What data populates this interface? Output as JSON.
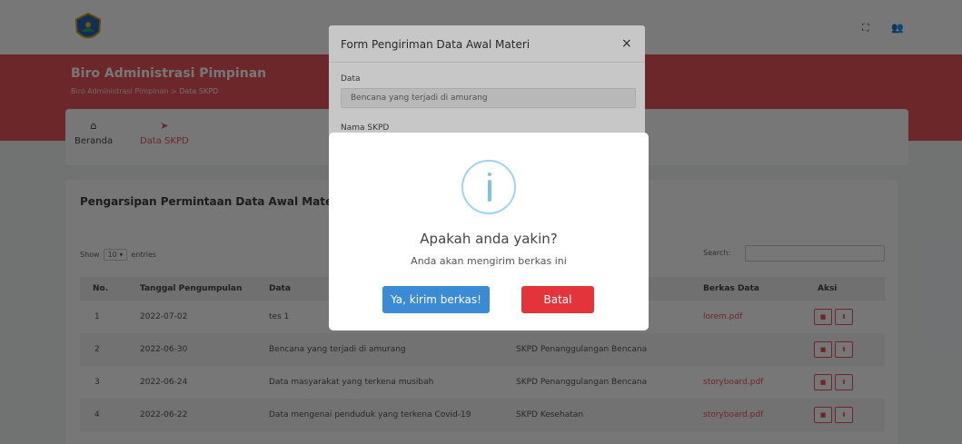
{
  "header": {
    "org_title": "Biro Administrasi Pimpinan",
    "breadcrumb_root": "Biro Administrasi Pimpinan",
    "breadcrumb_sep": ">",
    "breadcrumb_current": "Data SKPD",
    "fullscreen_icon": "fullscreen-icon",
    "user_icon": "user-icon"
  },
  "nav": {
    "home_label": "Beranda",
    "home_icon": "home-icon",
    "skpd_label": "Data SKPD",
    "skpd_icon": "send-icon"
  },
  "section": {
    "title": "Pengarsipan Permintaan Data Awal Materi",
    "show_label": "Show",
    "entries_value": "10",
    "entries_label": "entries",
    "search_label": "Search:"
  },
  "table": {
    "headers": [
      "No.",
      "Tanggal Pengumpulan",
      "Data",
      "",
      "Berkas Data",
      "Aksi"
    ],
    "rows": [
      {
        "no": "1",
        "date": "2022-07-02",
        "data": "tes 1",
        "skpd": "",
        "file": "lorem.pdf"
      },
      {
        "no": "2",
        "date": "2022-06-30",
        "data": "Bencana yang terjadi di amurang",
        "skpd": "SKPD Penanggulangan Bencana",
        "file": ""
      },
      {
        "no": "3",
        "date": "2022-06-24",
        "data": "Data masyarakat yang terkena musibah",
        "skpd": "SKPD Penanggulangan Bencana",
        "file": "storyboard.pdf"
      },
      {
        "no": "4",
        "date": "2022-06-22",
        "data": "Data mengenai penduduk yang terkena Covid-19",
        "skpd": "SKPD Kesehatan",
        "file": "storyboard.pdf"
      }
    ]
  },
  "form_modal": {
    "title": "Form Pengiriman Data Awal Materi",
    "close": "×",
    "data_label": "Data",
    "data_value": "Bencana yang terjadi di amurang",
    "skpd_label": "Nama SKPD"
  },
  "confirm": {
    "icon": "info-icon",
    "title": "Apakah anda yakin?",
    "text": "Anda akan mengirim berkas ini",
    "confirm_label": "Ya, kirim berkas!",
    "cancel_label": "Batal"
  },
  "colors": {
    "brand_red": "#e8545c",
    "confirm_blue": "#3b8ad6",
    "cancel_red": "#e3343c",
    "info_blue": "#9fd4f0"
  }
}
